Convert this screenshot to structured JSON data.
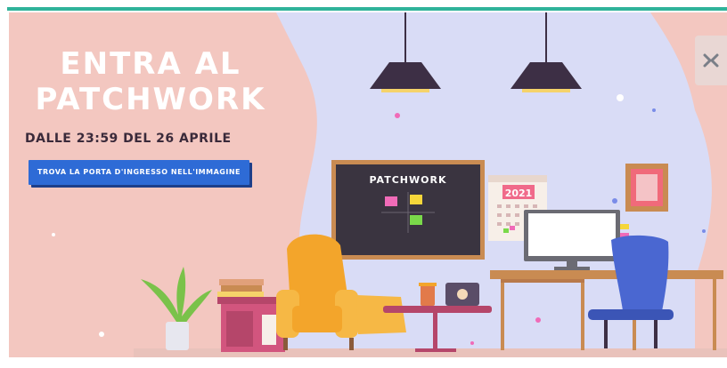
{
  "banner": {
    "headline_line1": "ENTRA AL",
    "headline_line2": "PATCHWORK",
    "subtitle": "DALLE 23:59 DEL 26 APRILE",
    "cta_label": "TROVA LA PORTA D'INGRESSO NELL'IMMAGINE",
    "board_title": "PATCHWORK",
    "calendar_year": "2021"
  },
  "colors": {
    "top_bar": "#2fb39a",
    "banner_background": "#f3c7c0",
    "blob": "#d9dcf6",
    "cta_background": "#2e6bd6",
    "chalkboard": "#3a3440",
    "armchair": "#f3a52b",
    "office_chair": "#4a67d1"
  },
  "icons": {
    "side_button": "tools-icon"
  }
}
